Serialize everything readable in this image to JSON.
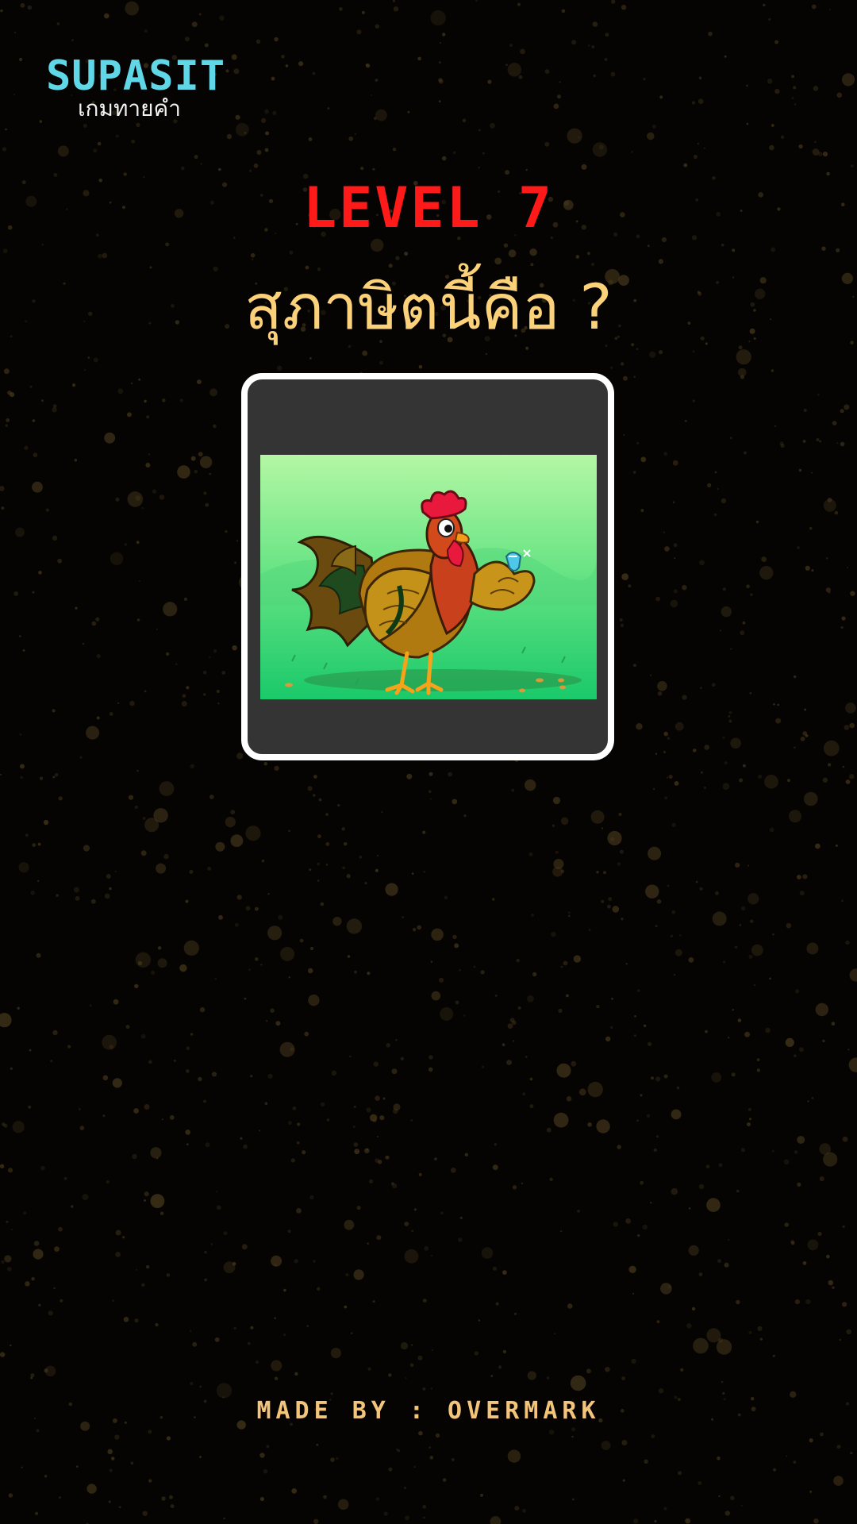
{
  "brand": {
    "title": "SUPASIT",
    "subtitle": "เกมทายคำ"
  },
  "game": {
    "level_label": "LEVEL 7",
    "question": "สุภาษิตนี้คือ ?",
    "clue_image": {
      "icon": "rooster-holding-gem-illustration"
    }
  },
  "footer": {
    "credit": "MADE BY : OVERMARK"
  },
  "colors": {
    "background": "#050403",
    "brand": "#5fd7e6",
    "level": "#ff1a1a",
    "question": "#fbd27a",
    "card_frame": "#ffffff",
    "card_fill": "#343434",
    "footer": "#f3c57a"
  }
}
